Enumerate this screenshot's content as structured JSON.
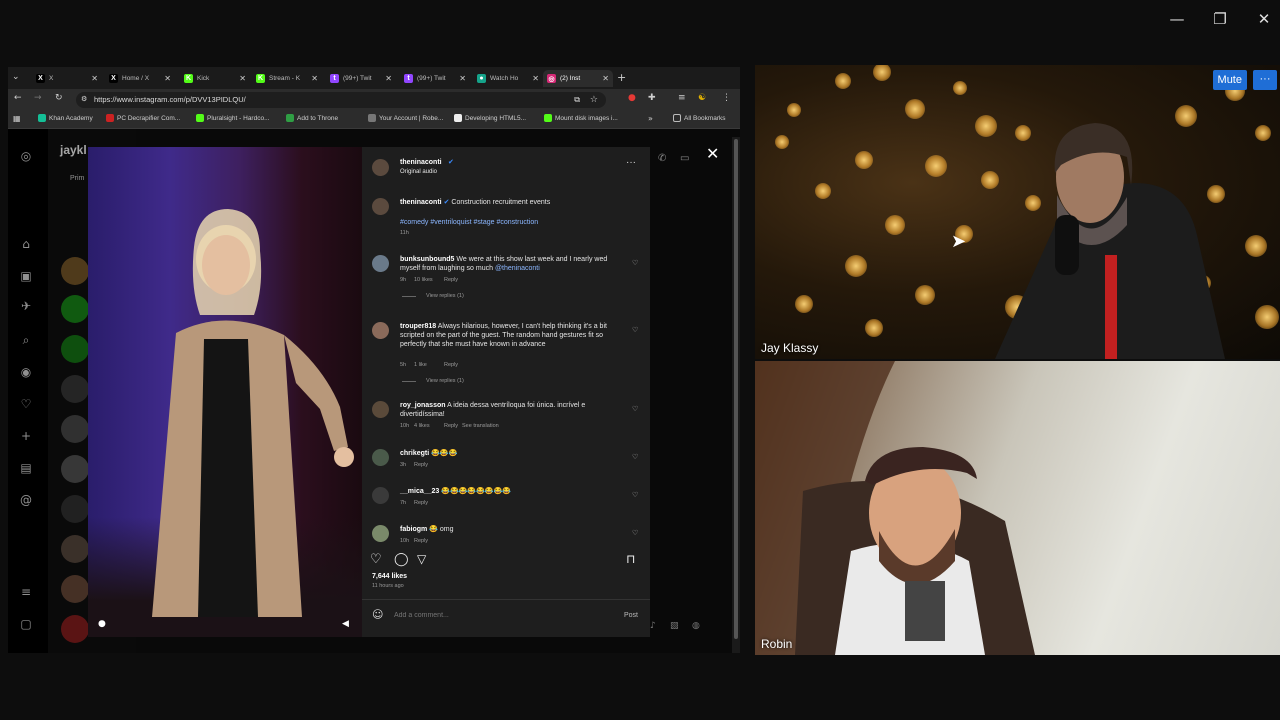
{
  "window": {
    "minimize": "—",
    "restore": "❐",
    "close": "✕"
  },
  "browser": {
    "tabs": [
      {
        "label": "X",
        "color": "#000000",
        "glyph": "X"
      },
      {
        "label": "Home / X",
        "color": "#000000",
        "glyph": "X"
      },
      {
        "label": "Kick",
        "color": "#53fc18",
        "glyph": "K"
      },
      {
        "label": "Stream - K",
        "color": "#53fc18",
        "glyph": "K"
      },
      {
        "label": "(99+) Twit",
        "color": "#9146ff",
        "glyph": "t"
      },
      {
        "label": "(99+) Twit",
        "color": "#9146ff",
        "glyph": "t"
      },
      {
        "label": "Watch Ho",
        "color": "#15a38a",
        "glyph": "●"
      },
      {
        "label": "(2) Inst",
        "color": "#d62976",
        "glyph": "◎"
      }
    ],
    "new_tab": "+",
    "url": "https://www.instagram.com/p/DVV13PIDLQU/",
    "bookmarks": [
      {
        "label": "Khan Academy",
        "color": "#14bf96"
      },
      {
        "label": "PC Decrapifier Com...",
        "color": "#cc2222"
      },
      {
        "label": "Pluralsight - Hardco...",
        "color": "#53fc18"
      },
      {
        "label": "Add to Throne",
        "color": "#2f9e44"
      },
      {
        "label": "Your Account | Robe...",
        "color": "#777777"
      },
      {
        "label": "Developing HTML5...",
        "color": "#eeeeee"
      },
      {
        "label": "Mount disk images i...",
        "color": "#53fc18"
      }
    ],
    "all_bookmarks": "All Bookmarks"
  },
  "instagram": {
    "sidebar_user": "jaykl",
    "mid_tab": "Prim",
    "post": {
      "author": "theninaconti",
      "audio": "Original audio",
      "caption": "Construction recruitment events",
      "hashtags": "#comedy #ventriloquist #stage #construction",
      "caption_time": "11h",
      "likes": "7,644 likes",
      "posted": "11 hours ago",
      "comment_placeholder": "Add a comment...",
      "post_button": "Post"
    },
    "comments": [
      {
        "user": "bunksunbound5",
        "text": "We were at this show last week and I nearly wed myself from laughing so much",
        "mention": "@theninaconti",
        "time": "9h",
        "likes": "10 likes",
        "reply": "Reply",
        "view_replies": "View replies (1)"
      },
      {
        "user": "trouper818",
        "text": "Always hilarious, however, I can't help thinking it's a bit scripted on the part of the guest. The random hand gestures fit so perfectly that she must have known in advance",
        "time": "5h",
        "likes": "1 like",
        "reply": "Reply",
        "view_replies": "View replies (1)"
      },
      {
        "user": "roy_jonasson",
        "text": "A ideia dessa ventríloqua foi única. incrível e divertidíssima!",
        "time": "10h",
        "likes": "4 likes",
        "reply": "Reply",
        "translate": "See translation"
      },
      {
        "user": "chrikegti",
        "text": "😂😂😂",
        "time": "3h",
        "reply": "Reply"
      },
      {
        "user": "__mica__23",
        "text": "😂😂😂😂😂😂😂😂",
        "time": "7h",
        "reply": "Reply"
      },
      {
        "user": "fabiogm",
        "text": "😂 omg",
        "time": "10h",
        "reply": "Reply"
      }
    ]
  },
  "call": {
    "mute_label": "Mute",
    "more_label": "···",
    "participants": [
      {
        "name": "Jay Klassy"
      },
      {
        "name": "Robin"
      }
    ]
  },
  "colors": {
    "accent_blue": "#1f6ed6",
    "link_blue": "#8cb7ff"
  }
}
